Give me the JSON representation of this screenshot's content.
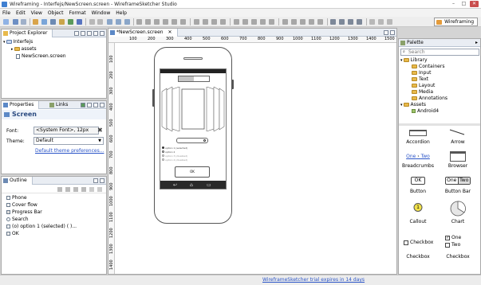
{
  "window": {
    "title": "Wireframing - Interfejs/NewScreen.screen - WireframeSketcher Studio",
    "controls": [
      "–",
      "□",
      "✕"
    ]
  },
  "menu": [
    "File",
    "Edit",
    "View",
    "Object",
    "Format",
    "Window",
    "Help"
  ],
  "toolbar": {
    "perspective_label": "Wireframing"
  },
  "colors": {
    "accent": "#3f7fd1",
    "link": "#2b55c8",
    "folder": "#e8b94a",
    "close": "#c94c4c"
  },
  "project_explorer": {
    "tab_label": "Project Explorer",
    "tree": [
      {
        "label": "Interfejs",
        "icon": "project-icon",
        "level": 0
      },
      {
        "label": "assets",
        "icon": "folder-icon",
        "level": 1
      },
      {
        "label": "NewScreen.screen",
        "icon": "screen-file-icon",
        "level": 1
      }
    ]
  },
  "properties": {
    "tab_label": "Properties",
    "links_tab_label": "Links",
    "heading": "Screen",
    "font_label": "Font:",
    "font_value": "<System Font>, 12px",
    "theme_label": "Theme:",
    "theme_value": "Default",
    "theme_link": "Default theme preferences..."
  },
  "outline": {
    "tab_label": "Outline",
    "items": [
      {
        "label": "Phone",
        "icon": "phone-icon"
      },
      {
        "label": "Cover flow",
        "icon": "coverflow-icon"
      },
      {
        "label": "Progress Bar",
        "icon": "progressbar-icon"
      },
      {
        "label": "Search",
        "icon": "search-icon"
      },
      {
        "label": "(o) option 1 (selected) ( )...",
        "icon": "radio-icon"
      },
      {
        "label": "OK",
        "icon": "button-icon"
      }
    ]
  },
  "editor": {
    "tab_label": "*NewScreen.screen",
    "ruler_h": [
      "100",
      "200",
      "300",
      "400",
      "500",
      "600",
      "700",
      "800",
      "900",
      "1000",
      "1100",
      "1200",
      "1300",
      "1400",
      "1500"
    ],
    "ruler_v": [
      "100",
      "200",
      "300",
      "400",
      "500",
      "600",
      "700",
      "800",
      "900",
      "1000",
      "1100",
      "1200",
      "1300",
      "1400"
    ],
    "button_label": "OK",
    "search_placeholder": "",
    "radio_options": [
      "option 1 (selected)",
      "option 2",
      "option 3 (disabled)",
      "option 4 (disabled)"
    ],
    "progress": 0.5
  },
  "palette": {
    "title": "Palette",
    "search_placeholder": "Search",
    "tree": [
      {
        "label": "Library",
        "level": 0
      },
      {
        "label": "Containers",
        "level": 1
      },
      {
        "label": "Input",
        "level": 1
      },
      {
        "label": "Text",
        "level": 1
      },
      {
        "label": "Layout",
        "level": 1
      },
      {
        "label": "Media",
        "level": 1
      },
      {
        "label": "Annotations",
        "level": 1
      },
      {
        "label": "Assets",
        "level": 0
      },
      {
        "label": "Android4",
        "level": 1
      }
    ],
    "items": [
      {
        "label": "Accordion"
      },
      {
        "label": "Arrow"
      },
      {
        "label": "Breadcrumbs",
        "crumb1": "One",
        "crumb2": "Two"
      },
      {
        "label": "Browser"
      },
      {
        "label": "Button",
        "text": "OK"
      },
      {
        "label": "Button Bar",
        "btn1": "One",
        "btn2": "Two"
      },
      {
        "label": "Callout",
        "text": "1"
      },
      {
        "label": "Chart"
      },
      {
        "label": "Checkbox",
        "text": "Checkbox"
      },
      {
        "label": "Checkbox",
        "opt1": "One",
        "opt2": "Two"
      }
    ]
  },
  "status": {
    "message": "WireframeSketcher trial expires in 14 days"
  }
}
